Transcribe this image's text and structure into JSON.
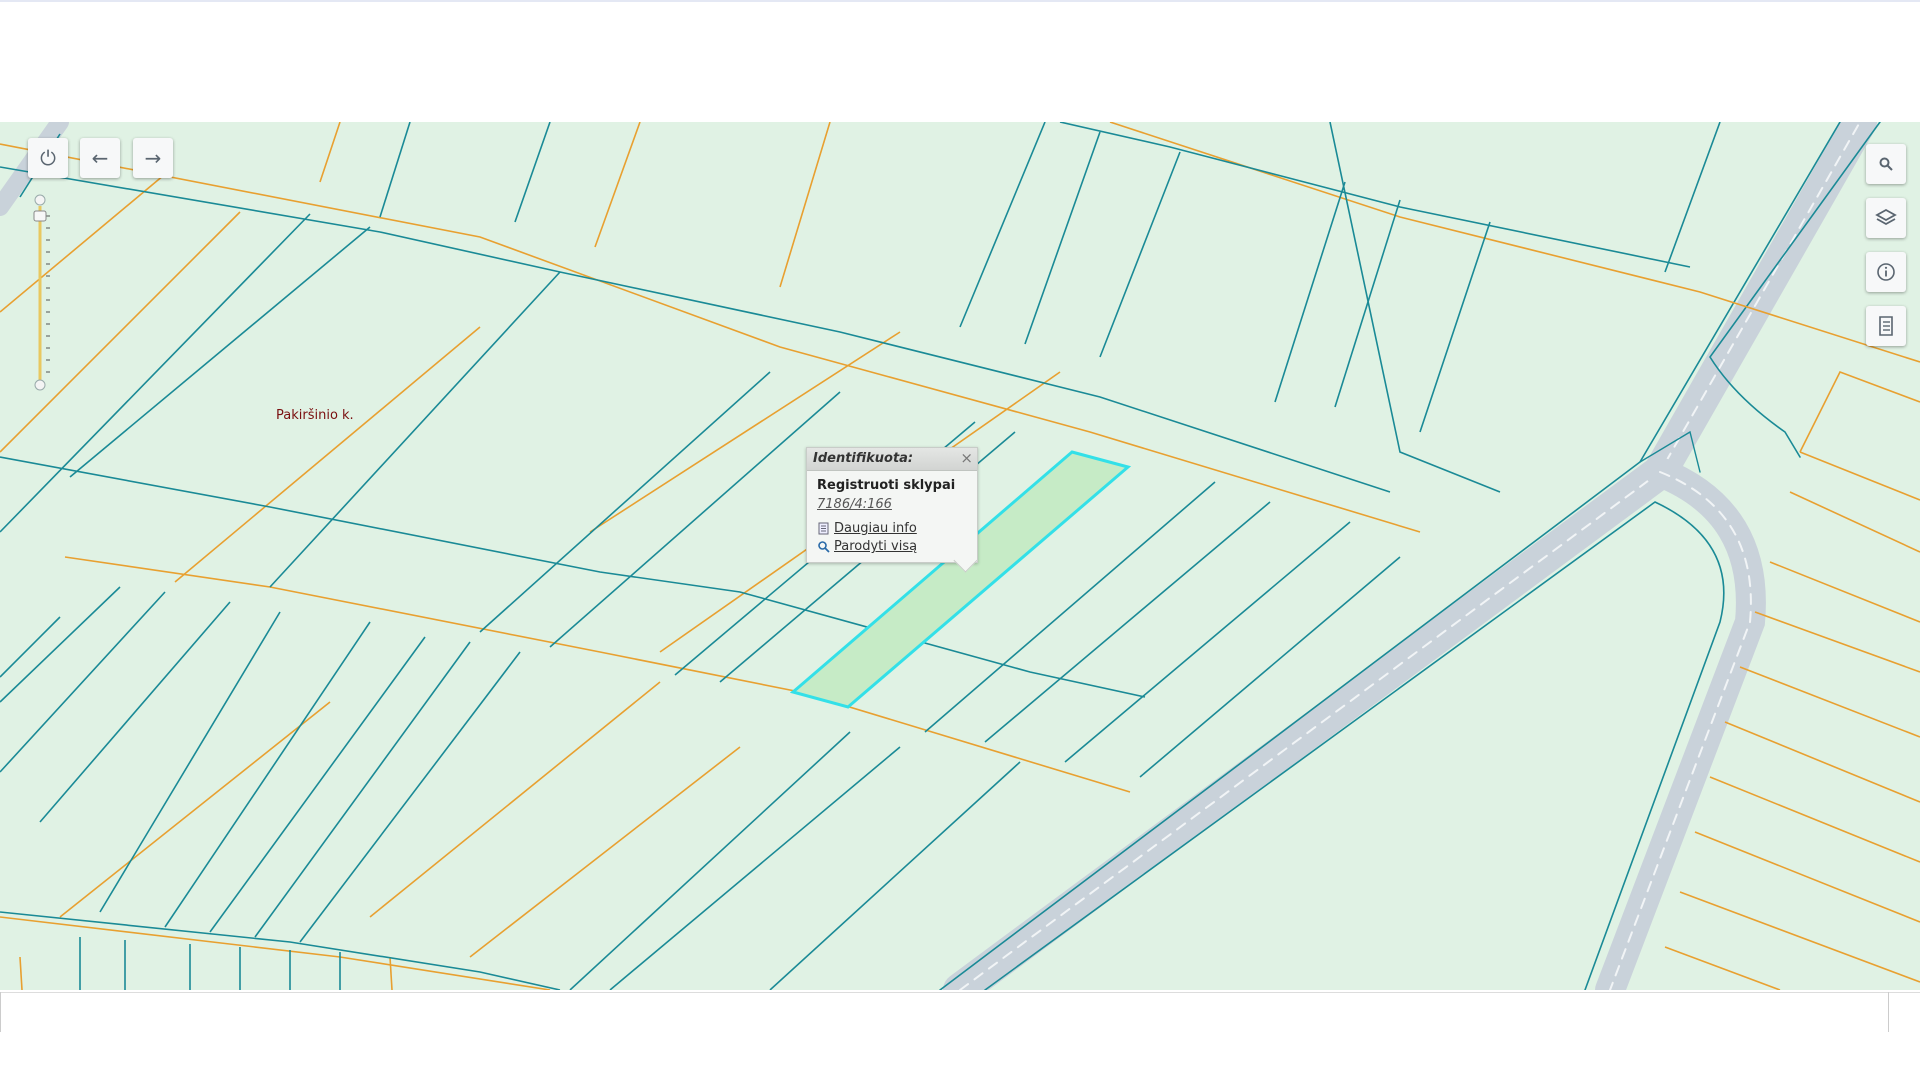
{
  "map": {
    "place_label": "Pakiršinio k.",
    "colors": {
      "background": "#e0f2e4",
      "parcel_boundary_teal": "#1a8a96",
      "parcel_boundary_orange": "#e8a030",
      "road": "#c9d2da",
      "selected_parcel_fill": "#c6ebc6",
      "selected_parcel_outline": "#33e0e8"
    }
  },
  "controls": {
    "left": [
      {
        "name": "power-icon",
        "glyph": "⏻"
      },
      {
        "name": "back-arrow-icon",
        "glyph": "←"
      },
      {
        "name": "forward-arrow-icon",
        "glyph": "→"
      }
    ],
    "right": [
      {
        "name": "search-icon"
      },
      {
        "name": "layers-icon"
      },
      {
        "name": "info-icon"
      },
      {
        "name": "legend-icon"
      }
    ]
  },
  "popup": {
    "title": "Identifikuota:",
    "close": "×",
    "layer_name": "Registruoti sklypai",
    "feature_id": "7186/4:166",
    "more_info": "Daugiau info",
    "show_all": "Parodyti visą"
  }
}
